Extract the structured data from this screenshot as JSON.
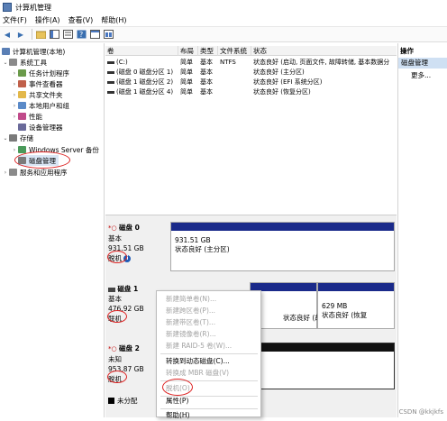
{
  "window": {
    "title": "计算机管理"
  },
  "menu": [
    "文件(F)",
    "操作(A)",
    "查看(V)",
    "帮助(H)"
  ],
  "toolbar_icons": [
    "back-arrow-icon",
    "forward-arrow-icon",
    "folder-up-icon",
    "show-hide-tree-icon",
    "properties-icon",
    "help-icon",
    "console-icon",
    "details-icon"
  ],
  "tree": {
    "root": "计算机管理(本地)",
    "system_tools": "系统工具",
    "task_scheduler": "任务计划程序",
    "event_viewer": "事件查看器",
    "shared_folders": "共享文件夹",
    "local_users": "本地用户和组",
    "performance": "性能",
    "device_manager": "设备管理器",
    "storage": "存储",
    "windows_backup": "Windows Server 备份",
    "disk_management": "磁盘管理",
    "services_apps": "服务和应用程序"
  },
  "volume_list": {
    "columns": [
      "卷",
      "布局",
      "类型",
      "文件系统",
      "状态"
    ],
    "rows": [
      {
        "volume": "(C:)",
        "layout": "简单",
        "type": "基本",
        "fs": "NTFS",
        "status": "状态良好 (启动, 页面文件, 故障转储, 基本数据分"
      },
      {
        "volume": "(磁盘 0 磁盘分区 1)",
        "layout": "简单",
        "type": "基本",
        "fs": "",
        "status": "状态良好 (主分区)"
      },
      {
        "volume": "(磁盘 1 磁盘分区 2)",
        "layout": "简单",
        "type": "基本",
        "fs": "",
        "status": "状态良好 (EFI 系统分区)"
      },
      {
        "volume": "(磁盘 1 磁盘分区 4)",
        "layout": "简单",
        "type": "基本",
        "fs": "",
        "status": "状态良好 (恢复分区)"
      }
    ]
  },
  "actions": {
    "title": "操作",
    "selected": "磁盘管理",
    "more": "更多..."
  },
  "disks": [
    {
      "name": "磁盘 0",
      "type": "基本",
      "size": "931.51 GB",
      "state": "脱机",
      "partition_size": "931.51 GB",
      "partition_status": "状态良好 (主分区)"
    },
    {
      "name": "磁盘 1",
      "type": "基本",
      "size": "476.92 GB",
      "state": "联机",
      "partition_a": "S",
      "partition_b_status": "状态良好 (故障转储",
      "partition_c_size": "629 MB",
      "partition_c_status": "状态良好 (恢复"
    },
    {
      "name": "磁盘 2",
      "type": "未知",
      "size": "953.87 GB",
      "state": "脱机"
    }
  ],
  "legend": {
    "unallocated": "未分配"
  },
  "context_menu": {
    "items": [
      {
        "label": "新建简单卷(N)...",
        "enabled": false
      },
      {
        "label": "新建跨区卷(P)...",
        "enabled": false
      },
      {
        "label": "新建带区卷(T)...",
        "enabled": false
      },
      {
        "label": "新建镜像卷(R)...",
        "enabled": false
      },
      {
        "label": "新建 RAID-5 卷(W)...",
        "enabled": false
      },
      {
        "label": "转换到动态磁盘(C)...",
        "enabled": true
      },
      {
        "label": "转换成 MBR 磁盘(V)",
        "enabled": false
      },
      {
        "label": "脱机(O)",
        "enabled": false
      },
      {
        "label": "属性(P)",
        "enabled": true
      },
      {
        "label": "帮助(H)",
        "enabled": true
      }
    ]
  },
  "watermark": "CSDN @kkjkfs",
  "colors": {
    "partition_header": "#1a2a8a",
    "annotation": "#dd2222",
    "action_selected": "#cfe0f3"
  }
}
